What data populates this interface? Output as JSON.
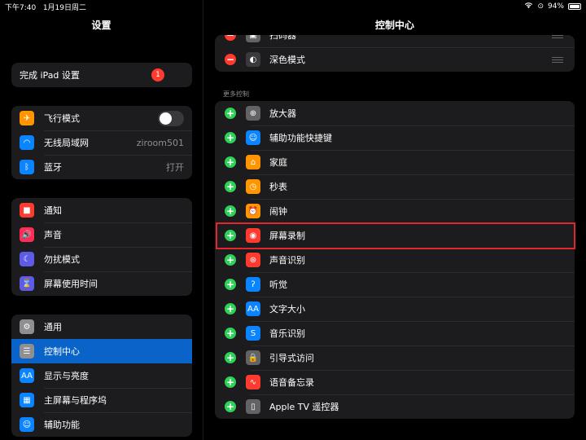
{
  "status": {
    "time": "下午7:40",
    "date": "1月19日周二",
    "battery": "94%"
  },
  "settings": {
    "title": "设置",
    "ipad_setup": {
      "label": "完成 iPad 设置",
      "badge": "1"
    },
    "network": [
      {
        "label": "飞行模式",
        "icon": "airplane-icon",
        "color": "#ff9500",
        "glyph": "✈",
        "toggle": false
      },
      {
        "label": "无线局域网",
        "icon": "wifi-icon",
        "color": "#0a84ff",
        "glyph": "◠",
        "value": "ziroom501"
      },
      {
        "label": "蓝牙",
        "icon": "bluetooth-icon",
        "color": "#0a84ff",
        "glyph": "ᛒ",
        "value": "打开"
      }
    ],
    "notifications": [
      {
        "label": "通知",
        "icon": "notifications-icon",
        "color": "#ff3b30",
        "glyph": "■"
      },
      {
        "label": "声音",
        "icon": "sound-icon",
        "color": "#ff2d55",
        "glyph": "🔊"
      },
      {
        "label": "勿扰模式",
        "icon": "moon-icon",
        "color": "#5e5ce6",
        "glyph": "☾"
      },
      {
        "label": "屏幕使用时间",
        "icon": "hourglass-icon",
        "color": "#5e5ce6",
        "glyph": "⌛"
      }
    ],
    "general": [
      {
        "label": "通用",
        "icon": "gear-icon",
        "color": "#8e8e93",
        "glyph": "⚙"
      },
      {
        "label": "控制中心",
        "icon": "control-center-icon",
        "color": "#8e8e93",
        "glyph": "☰",
        "selected": true
      },
      {
        "label": "显示与亮度",
        "icon": "display-brightness-icon",
        "color": "#0a84ff",
        "glyph": "AA"
      },
      {
        "label": "主屏幕与程序坞",
        "icon": "home-screen-icon",
        "color": "#0a84ff",
        "glyph": "▦"
      },
      {
        "label": "辅助功能",
        "icon": "accessibility-icon",
        "color": "#0a84ff",
        "glyph": "☺"
      }
    ]
  },
  "control_center": {
    "title": "控制中心",
    "included": [
      {
        "label": "扫码器",
        "icon": "qr-scanner-icon",
        "color": "#636366",
        "glyph": "▣"
      },
      {
        "label": "深色模式",
        "icon": "dark-mode-icon",
        "color": "#3a3a3c",
        "glyph": "◐"
      }
    ],
    "more_header": "更多控制",
    "more": [
      {
        "label": "放大器",
        "icon": "magnifier-icon",
        "color": "#636366",
        "glyph": "⊕"
      },
      {
        "label": "辅助功能快捷键",
        "icon": "accessibility-shortcut-icon",
        "color": "#0a84ff",
        "glyph": "☺"
      },
      {
        "label": "家庭",
        "icon": "home-icon",
        "color": "#ff9500",
        "glyph": "⌂"
      },
      {
        "label": "秒表",
        "icon": "stopwatch-icon",
        "color": "#ff9500",
        "glyph": "◷"
      },
      {
        "label": "闹钟",
        "icon": "alarm-icon",
        "color": "#ff9500",
        "glyph": "⏰"
      },
      {
        "label": "屏幕录制",
        "icon": "screen-recording-icon",
        "color": "#ff3b30",
        "glyph": "◉"
      },
      {
        "label": "声音识别",
        "icon": "sound-recognition-icon",
        "color": "#ff3b30",
        "glyph": "⊛"
      },
      {
        "label": "听觉",
        "icon": "hearing-icon",
        "color": "#0a84ff",
        "glyph": "ʔ"
      },
      {
        "label": "文字大小",
        "icon": "text-size-icon",
        "color": "#0a84ff",
        "glyph": "AA"
      },
      {
        "label": "音乐识别",
        "icon": "shazam-icon",
        "color": "#0a84ff",
        "glyph": "S"
      },
      {
        "label": "引导式访问",
        "icon": "guided-access-icon",
        "color": "#636366",
        "glyph": "🔒"
      },
      {
        "label": "语音备忘录",
        "icon": "voice-memos-icon",
        "color": "#ff3b30",
        "glyph": "∿"
      },
      {
        "label": "Apple TV 遥控器",
        "icon": "apple-tv-remote-icon",
        "color": "#636366",
        "glyph": "▯"
      }
    ]
  }
}
